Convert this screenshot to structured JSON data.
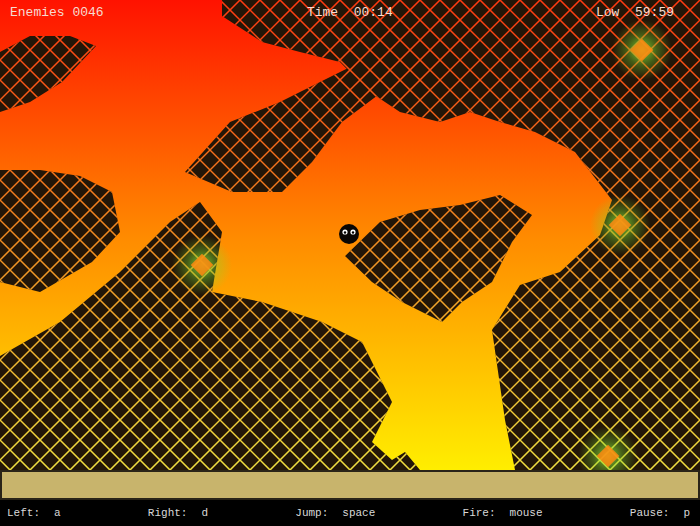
{
  "hud": {
    "enemies": "Enemies 0046",
    "time": "Time  00:14",
    "low": "Low  59:59"
  },
  "health_bar": {
    "level": 1
  },
  "controls": [
    {
      "label": "Left:",
      "key": "a"
    },
    {
      "label": "Right:",
      "key": "d"
    },
    {
      "label": "Jump:",
      "key": "space"
    },
    {
      "label": "Fire:",
      "key": "mouse"
    },
    {
      "label": "Pause:",
      "key": "p"
    }
  ]
}
